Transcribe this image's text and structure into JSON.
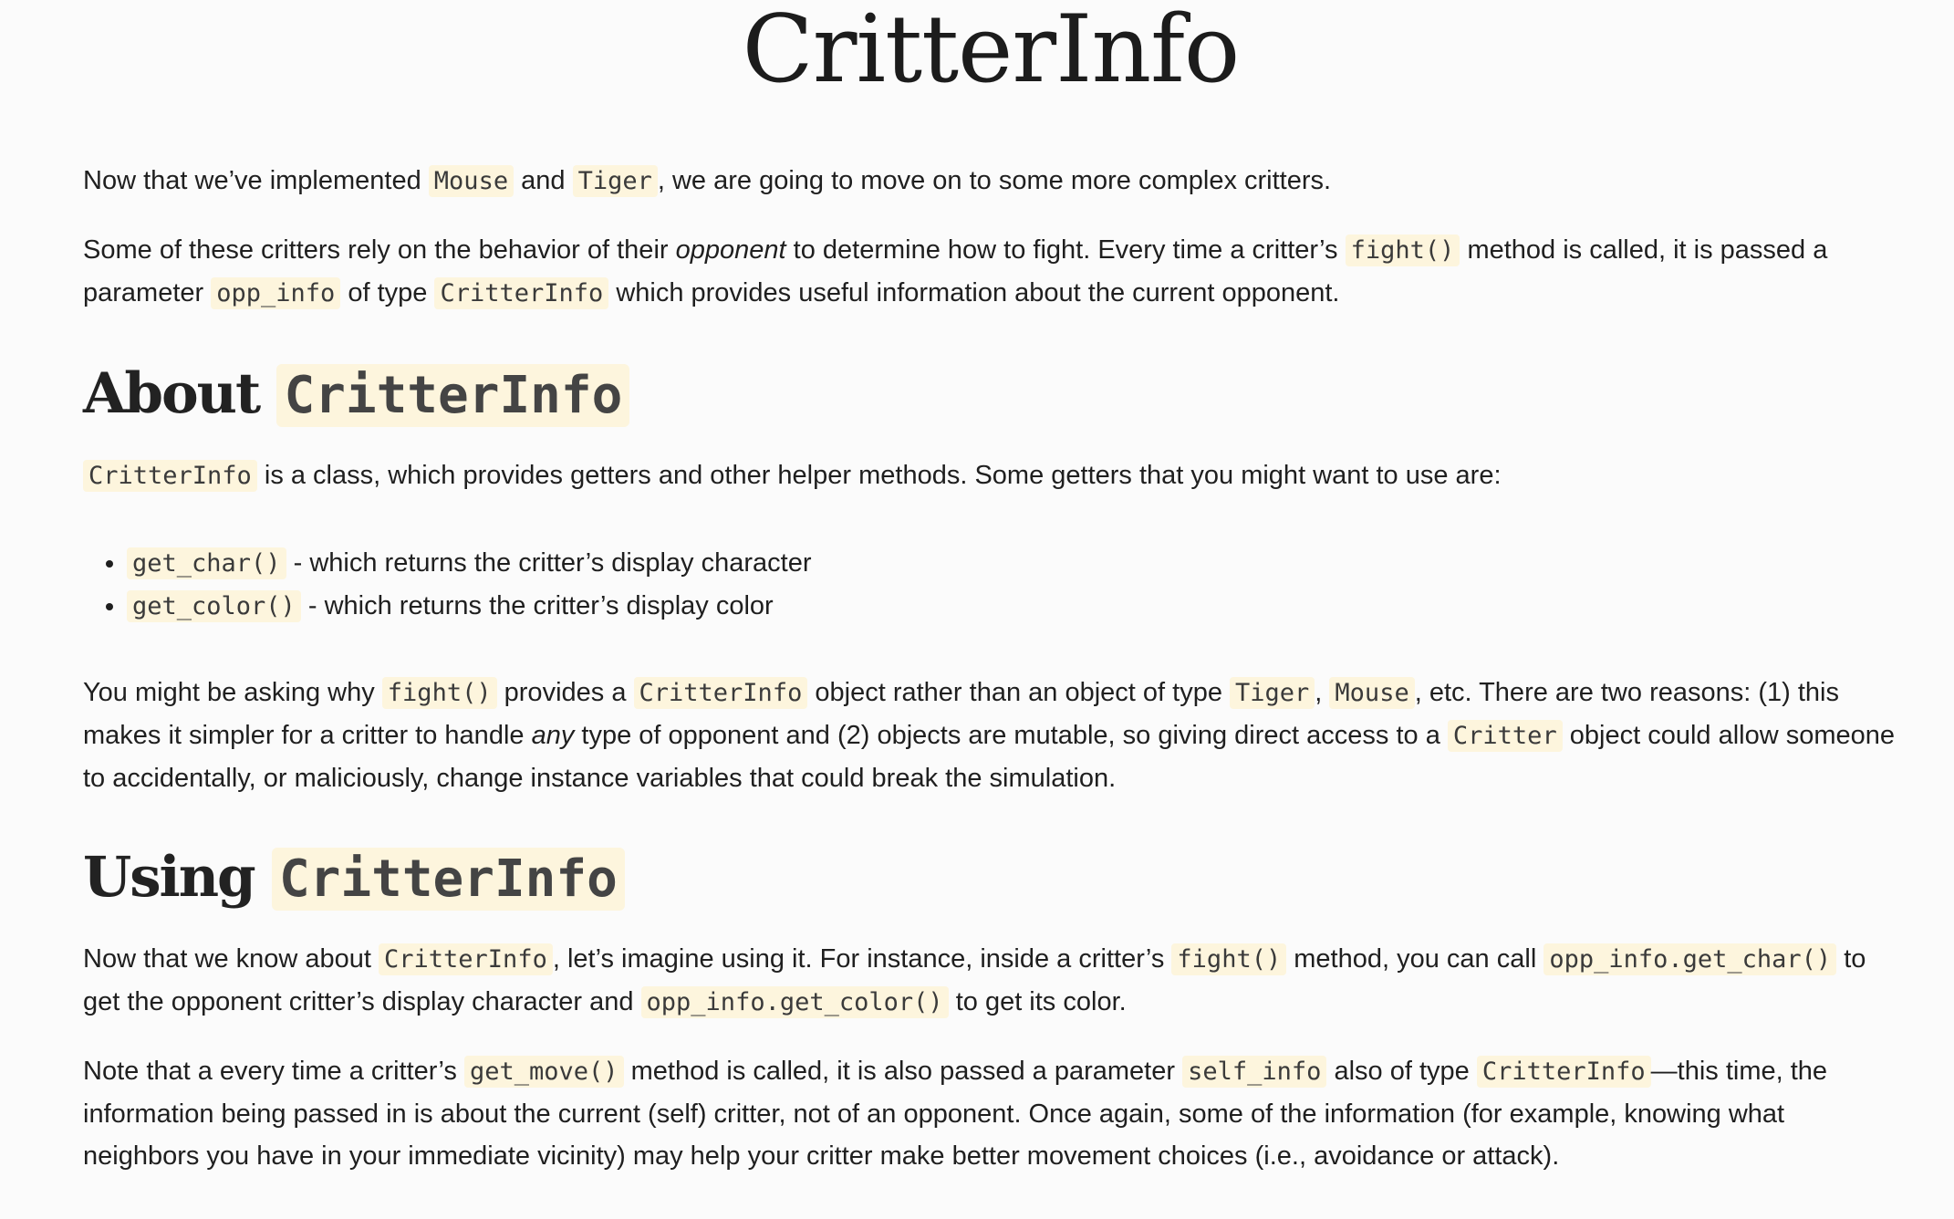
{
  "title": "CritterInfo",
  "intro": {
    "p1": {
      "t1": "Now that we’ve implemented ",
      "c1": "Mouse",
      "t2": " and ",
      "c2": "Tiger",
      "t3": ", we are going to move on to some more complex critters."
    },
    "p2": {
      "t1": "Some of these critters rely on the behavior of their ",
      "em1": "opponent",
      "t2": " to determine how to fight. Every time a critter’s ",
      "c1": "fight()",
      "t3": " method is called, it is passed a parameter ",
      "c2": "opp_info",
      "t4": " of type ",
      "c3": "CritterInfo",
      "t5": " which provides useful information about the current opponent."
    }
  },
  "about": {
    "heading_text": "About ",
    "heading_code": "CritterInfo",
    "p3": {
      "c1": "CritterInfo",
      "t1": " is a class, which provides getters and other helper methods. Some getters that you might want to use are:"
    },
    "list": [
      {
        "code": "get_char()",
        "text": " - which returns the critter’s display character"
      },
      {
        "code": "get_color()",
        "text": " - which returns the critter’s display color"
      }
    ],
    "p4": {
      "t1": "You might be asking why ",
      "c1": "fight()",
      "t2": " provides a ",
      "c2": "CritterInfo",
      "t3": " object rather than an object of type ",
      "c3": "Tiger",
      "t4": ", ",
      "c4": "Mouse",
      "t5": ", etc. There are two reasons: (1) this makes it simpler for a critter to handle ",
      "em1": "any",
      "t6": " type of opponent and (2) objects are mutable, so giving direct access to a ",
      "c5": "Critter",
      "t7": " object could allow someone to accidentally, or maliciously, change instance variables that could break the simulation."
    }
  },
  "using": {
    "heading_text": "Using ",
    "heading_code": "CritterInfo",
    "p5": {
      "t1": "Now that we know about ",
      "c1": "CritterInfo",
      "t2": ", let’s imagine using it. For instance, inside a critter’s ",
      "c2": "fight()",
      "t3": " method, you can call ",
      "c3": "opp_info.get_char()",
      "t4": " to get the opponent critter’s display character and ",
      "c4": "opp_info.get_color()",
      "t5": " to get its color."
    },
    "p6": {
      "t1": "Note that a every time a critter’s ",
      "c1": "get_move()",
      "t2": " method is called, it is also passed a parameter ",
      "c2": "self_info",
      "t3": " also of type ",
      "c3": "CritterInfo",
      "t4": "—this time, the information being passed in is about the current (self) critter, not of an opponent. Once again, some of the information (for example, knowing what neighbors you have in your immediate vicinity) may help your critter make better movement choices (i.e., avoidance or attack)."
    }
  }
}
